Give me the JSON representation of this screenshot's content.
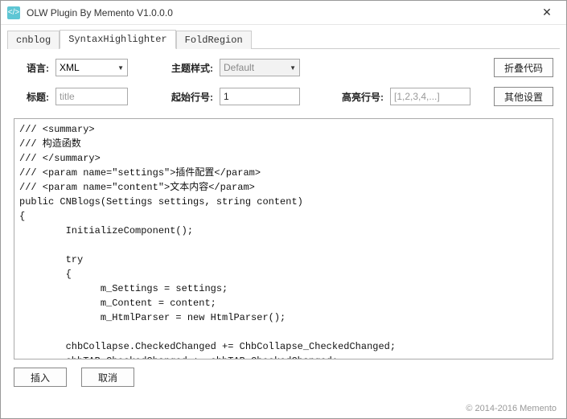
{
  "window": {
    "title": "OLW Plugin By Memento V1.0.0.0",
    "icon_glyph": "</>"
  },
  "tabs": [
    {
      "label": "cnblog",
      "active": false
    },
    {
      "label": "SyntaxHighlighter",
      "active": true
    },
    {
      "label": "FoldRegion",
      "active": false
    }
  ],
  "row1": {
    "lang_label": "语言:",
    "lang_value": "XML",
    "theme_label": "主题样式:",
    "theme_value": "Default",
    "fold_btn": "折叠代码"
  },
  "row2": {
    "title_label": "标题:",
    "title_placeholder": "title",
    "startline_label": "起始行号:",
    "startline_value": "1",
    "highlight_label": "高亮行号:",
    "highlight_placeholder": "[1,2,3,4,...]",
    "other_btn": "其他设置"
  },
  "code": "/// <summary>\n/// 构造函数\n/// </summary>\n/// <param name=\"settings\">插件配置</param>\n/// <param name=\"content\">文本内容</param>\npublic CNBlogs(Settings settings, string content)\n{\n        InitializeComponent();\n\n        try\n        {\n              m_Settings = settings;\n              m_Content = content;\n              m_HtmlParser = new HtmlParser();\n\n        chbCollapse.CheckedChanged += ChbCollapse_CheckedChanged;\n        chbTAB.CheckedChanged += chbTAB_CheckedChanged;\n        chbShowLineNum.CheckedChanged += ChbShowLineNum_CheckedChanged;\n\n        Load += CNBlogs_Load;",
  "bottom": {
    "insert": "插入",
    "cancel": "取消"
  },
  "copyright": "© 2014-2016 Memento"
}
